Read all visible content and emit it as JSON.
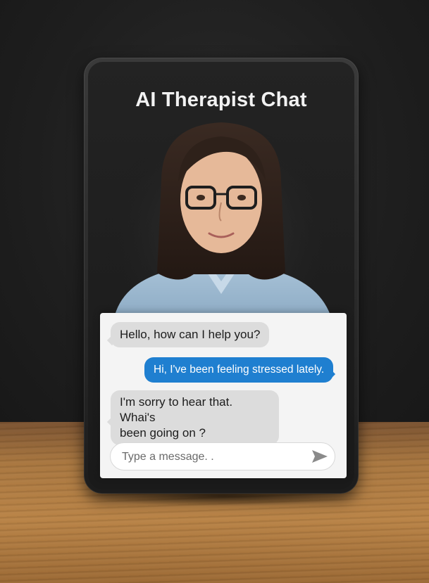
{
  "app": {
    "title": "AI Therapist Chat"
  },
  "therapist": {
    "avatar": "woman-with-glasses-avatar"
  },
  "messages": [
    {
      "sender": "therapist",
      "text": "Hello, how can I help you?"
    },
    {
      "sender": "user",
      "text": "Hi, I've been feeling stressed lately."
    },
    {
      "sender": "therapist",
      "lines": [
        "I'm sorry to hear that. Whai's",
        "been going on ?"
      ]
    }
  ],
  "composer": {
    "placeholder": "Type a message. .",
    "send_icon": "send-icon"
  },
  "colors": {
    "user_bubble": "#1f7fd0",
    "therapist_bubble": "#dcdcdc",
    "panel": "#f4f4f4",
    "title": "#f2f2f2"
  }
}
